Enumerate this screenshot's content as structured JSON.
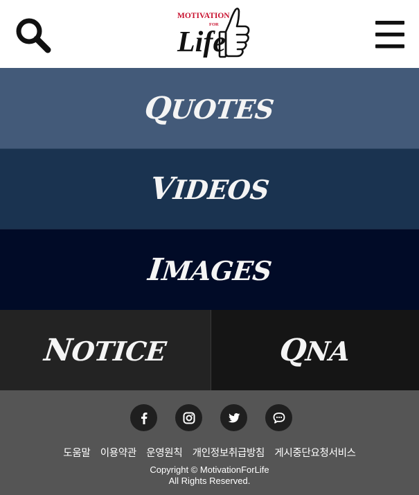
{
  "header": {
    "search_icon": "search-icon",
    "menu_icon": "hamburger-menu-icon",
    "logo": {
      "top_text": "MOTIVATION",
      "for_text": "FOR",
      "main_text": "Life"
    }
  },
  "nav": {
    "quotes": {
      "first": "Q",
      "rest": "UOTES"
    },
    "videos": {
      "first": "V",
      "rest": "IDEOS"
    },
    "images": {
      "first": "I",
      "rest": "MAGES"
    },
    "notice": {
      "first": "N",
      "rest": "OTICE"
    },
    "qna": {
      "first": "Q",
      "rest": "NA"
    }
  },
  "footer": {
    "social": [
      "facebook-icon",
      "instagram-icon",
      "twitter-icon",
      "chat-bubble-icon"
    ],
    "links": [
      "도움말",
      "이용약관",
      "운영원칙",
      "개인정보취급방침",
      "게시중단요청서비스"
    ],
    "copyright_line1": "Copyright © MotivationForLife",
    "copyright_line2": "All Rights Reserved."
  },
  "colors": {
    "quotes_bg": "#435a79",
    "videos_bg": "#1a3350",
    "images_bg": "#010b27",
    "notice_bg": "#232323",
    "qna_bg": "#151515",
    "footer_bg": "#555555",
    "logo_red": "#c8102e"
  }
}
